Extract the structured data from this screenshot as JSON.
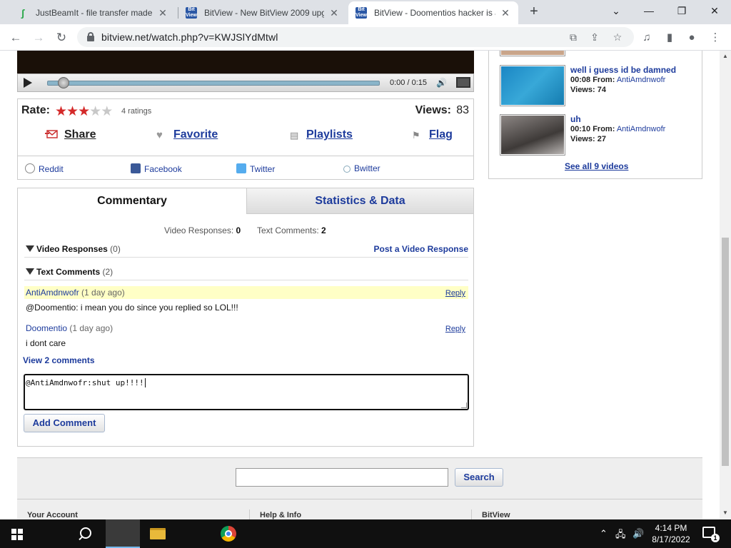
{
  "browser": {
    "tabs": [
      {
        "title": "JustBeamIt - file transfer made e",
        "active": false
      },
      {
        "title": "BitView - New BitView 2009 upg",
        "active": false
      },
      {
        "title": "BitView - Doomentios hacker is a",
        "active": true
      }
    ],
    "new_tab_label": "+",
    "url": "bitview.net/watch.php?v=KWJSlYdMtwl"
  },
  "player": {
    "time": "0:00 / 0:15",
    "progress_fraction": 0.0
  },
  "rating": {
    "label": "Rate:",
    "stars_filled": 3,
    "stars_total": 5,
    "count_text": "4 ratings",
    "views_label": "Views:",
    "views_value": "83"
  },
  "actions": {
    "share": "Share",
    "favorite": "Favorite",
    "playlists": "Playlists",
    "flag": "Flag"
  },
  "social": {
    "reddit": "Reddit",
    "facebook": "Facebook",
    "twitter": "Twitter",
    "bwitter": "Bwitter"
  },
  "comment_tabs": {
    "commentary": "Commentary",
    "stats": "Statistics & Data"
  },
  "counts": {
    "video_responses_label": "Video Responses:",
    "video_responses_value": "0",
    "text_comments_label": "Text Comments:",
    "text_comments_value": "2"
  },
  "sections": {
    "video_responses_title": "Video Responses",
    "video_responses_count": "(0)",
    "post_video_response": "Post a Video Response",
    "text_comments_title": "Text Comments",
    "text_comments_count": "(2)"
  },
  "comments": [
    {
      "user": "AntiAmdnwofr",
      "age": "(1 day ago)",
      "text": "@Doomentio: i mean you do since you replied so LOL!!!",
      "reply": "Reply",
      "highlighted": true
    },
    {
      "user": "Doomentio",
      "age": "(1 day ago)",
      "text": "i dont care",
      "reply": "Reply",
      "highlighted": false
    }
  ],
  "view_comments_link": "View 2 comments",
  "comment_input_value": "@AntiAmdnwofr:shut up!!!!",
  "add_comment_label": "Add Comment",
  "sidebar": {
    "videos": [
      {
        "title": "well i guess id be damned",
        "duration": "00:08",
        "from_label": "From:",
        "author": "AntiAmdnwofr",
        "views_label": "Views:",
        "views": "74"
      },
      {
        "title": "uh",
        "duration": "00:10",
        "from_label": "From:",
        "author": "AntiAmdnwofr",
        "views_label": "Views:",
        "views": "27"
      }
    ],
    "see_all": "See all 9 videos"
  },
  "footer": {
    "search_placeholder": "",
    "search_button": "Search",
    "col1": "Your Account",
    "col2": "Help & Info",
    "col3": "BitView"
  },
  "taskbar": {
    "time": "4:14 PM",
    "date": "8/17/2022",
    "notification_count": "1"
  },
  "colors": {
    "link": "#1d3b9c",
    "star_on": "#d42a2a",
    "highlight": "#ffffc6"
  }
}
